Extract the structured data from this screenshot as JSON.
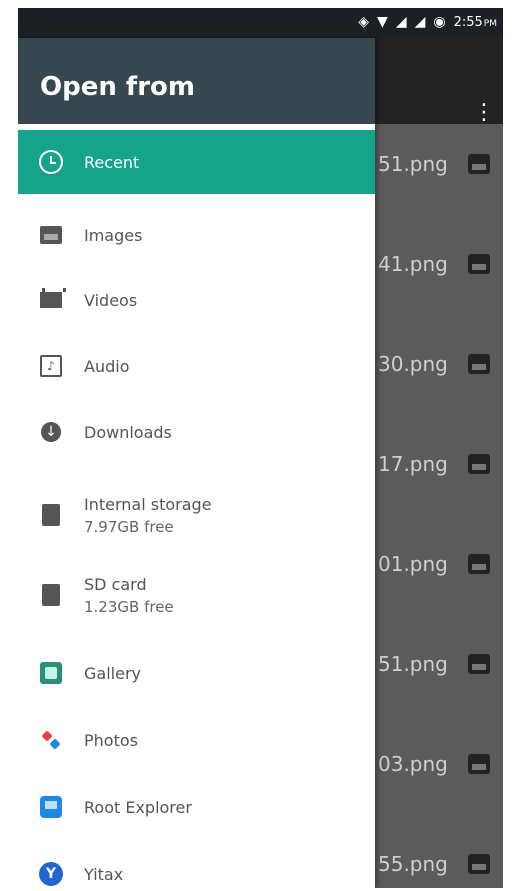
{
  "status_bar": {
    "time": "2:55",
    "ampm": "PM"
  },
  "drawer": {
    "title": "Open from",
    "items": [
      {
        "label": "Recent",
        "sub": "",
        "icon": "clock-icon",
        "active": true
      },
      {
        "label": "Images",
        "sub": "",
        "icon": "image-icon"
      },
      {
        "label": "Videos",
        "sub": "",
        "icon": "video-icon"
      },
      {
        "label": "Audio",
        "sub": "",
        "icon": "audio-icon"
      },
      {
        "label": "Downloads",
        "sub": "",
        "icon": "download-icon"
      },
      {
        "label": "Internal storage",
        "sub": "7.97GB free",
        "icon": "sdcard-icon"
      },
      {
        "label": "SD card",
        "sub": "1.23GB free",
        "icon": "sdcard-icon"
      },
      {
        "label": "Gallery",
        "sub": "",
        "icon": "gallery-icon"
      },
      {
        "label": "Photos",
        "sub": "",
        "icon": "photos-icon"
      },
      {
        "label": "Root Explorer",
        "sub": "",
        "icon": "root-explorer-icon"
      },
      {
        "label": "Yitax",
        "sub": "",
        "icon": "yitax-icon"
      }
    ]
  },
  "background_files": [
    {
      "name": "51.png"
    },
    {
      "name": "41.png"
    },
    {
      "name": "30.png"
    },
    {
      "name": "17.png"
    },
    {
      "name": "01.png"
    },
    {
      "name": "51.png"
    },
    {
      "name": "03.png"
    },
    {
      "name": "55.png"
    }
  ]
}
